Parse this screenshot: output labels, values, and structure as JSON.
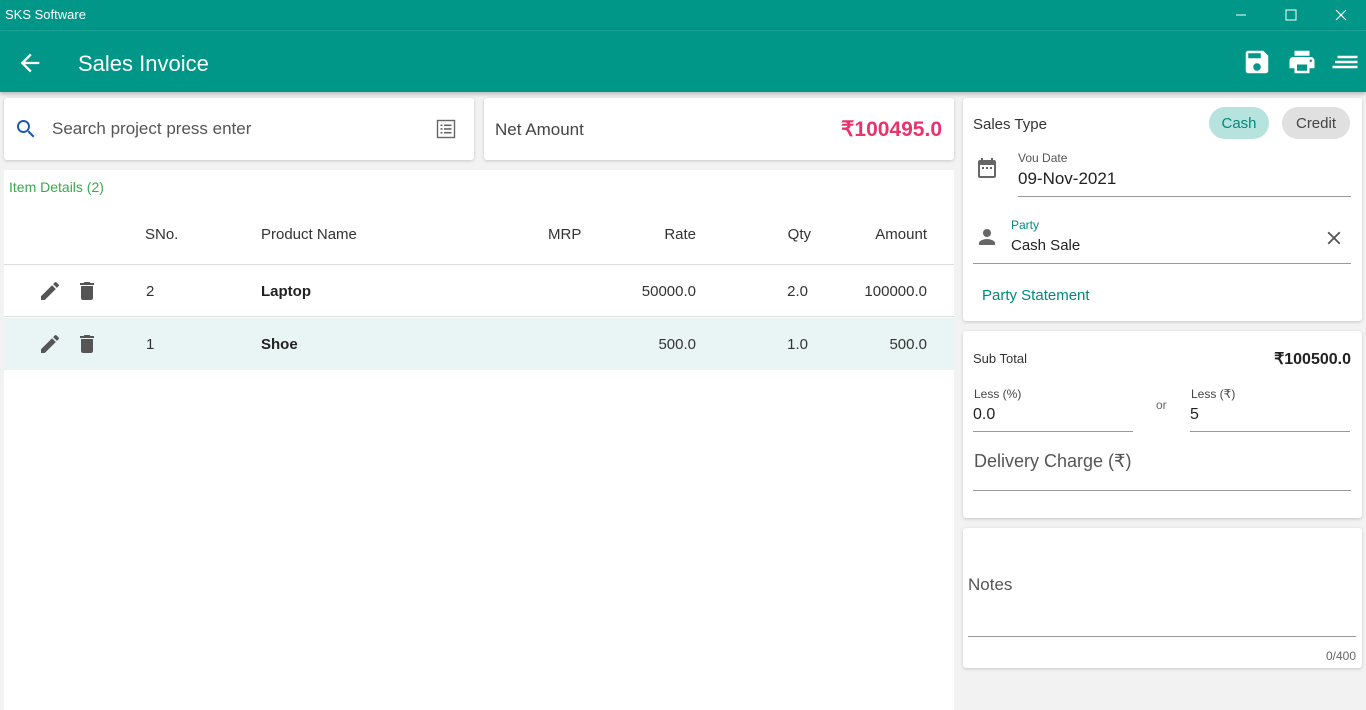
{
  "window": {
    "title": "SKS Software",
    "icons": [
      "minimize-icon",
      "maximize-icon",
      "close-icon"
    ]
  },
  "appbar": {
    "title": "Sales Invoice",
    "back_icon": "arrow-left-icon",
    "actions": [
      "save-icon",
      "print-icon",
      "menu-icon"
    ]
  },
  "search": {
    "placeholder": "Search project press enter",
    "value": ""
  },
  "net_amount": {
    "label": "Net Amount",
    "value": "₹100495.0",
    "color": "#e8336d"
  },
  "items": {
    "title": "Item Details (2)",
    "columns": [
      "SNo.",
      "Product Name",
      "MRP",
      "Rate",
      "Qty",
      "Amount"
    ],
    "rows": [
      {
        "sno": "2",
        "product": "Laptop",
        "mrp": "",
        "rate": "50000.0",
        "qty": "2.0",
        "amount": "100000.0"
      },
      {
        "sno": "1",
        "product": "Shoe",
        "mrp": "",
        "rate": "500.0",
        "qty": "1.0",
        "amount": "500.0"
      }
    ]
  },
  "sales": {
    "type_label": "Sales Type",
    "cash": "Cash",
    "credit": "Credit",
    "selected": "Cash",
    "vou_date_label": "Vou Date",
    "vou_date_value": "09-Nov-2021",
    "party_label": "Party",
    "party_value": "Cash Sale",
    "party_statement": "Party Statement"
  },
  "totals": {
    "sub_total_label": "Sub Total",
    "sub_total_value": "₹100500.0",
    "less_pct_label": "Less (%)",
    "less_pct_value": "0.0",
    "or_label": "or",
    "less_amt_label": "Less (₹)",
    "less_amt_value": "5",
    "delivery_label": "Delivery Charge (₹)"
  },
  "notes": {
    "label": "Notes",
    "counter": "0/400"
  },
  "colors": {
    "primary": "#009688",
    "accent": "#00897b",
    "amount": "#e8336d",
    "item_title": "#3aa84f"
  }
}
